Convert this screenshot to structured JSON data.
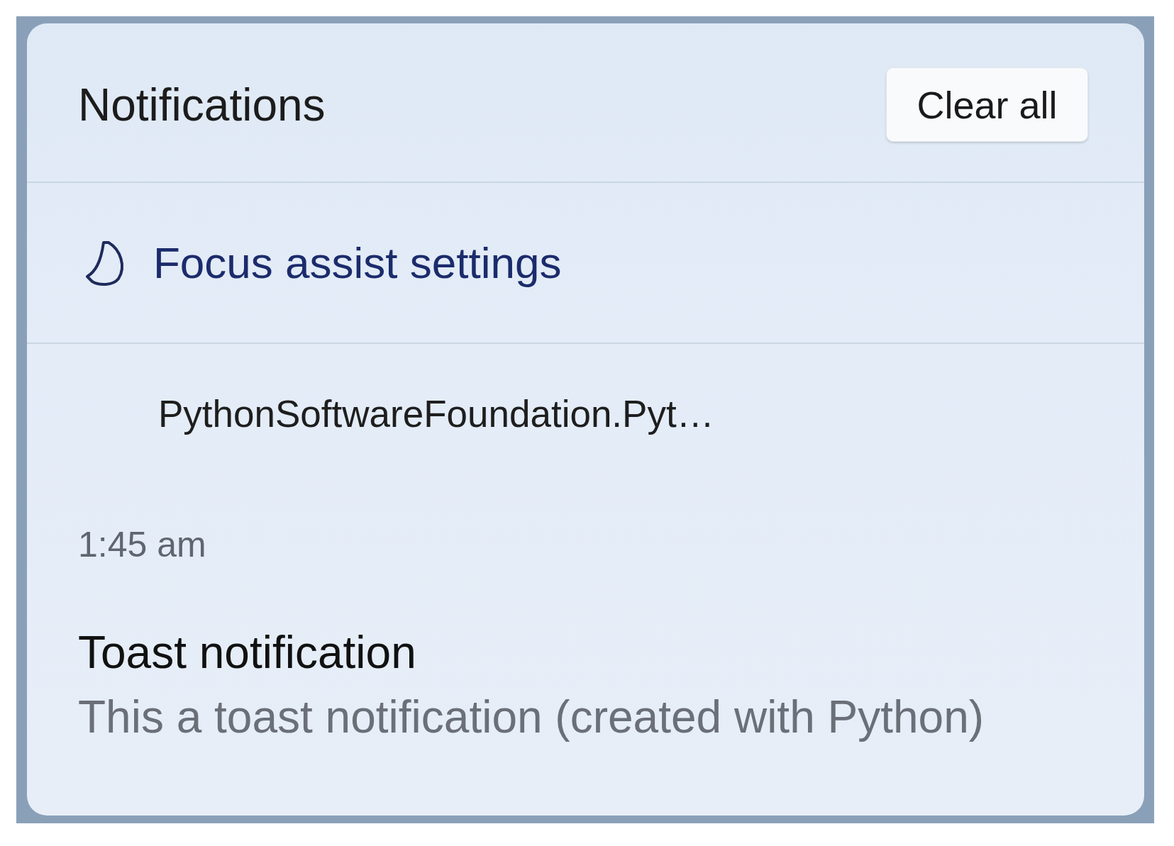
{
  "panel": {
    "title": "Notifications",
    "clear_button": "Clear all"
  },
  "focus_assist": {
    "label": "Focus assist settings"
  },
  "notifications": [
    {
      "app": "PythonSoftwareFoundation.Pyt…",
      "time": "1:45 am",
      "title": "Toast notification",
      "body": "This a toast notification (created with Python)"
    }
  ]
}
